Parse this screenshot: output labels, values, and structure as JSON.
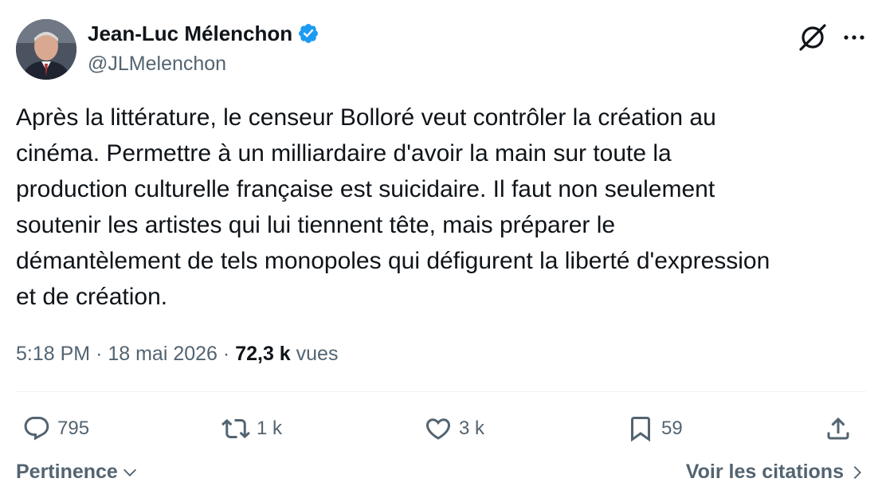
{
  "author": {
    "display_name": "Jean-Luc Mélenchon",
    "handle": "@JLMelenchon",
    "verified_color": "#1d9bf0"
  },
  "header_icons": [
    "grok-icon",
    "more-icon"
  ],
  "tweet": {
    "text": "Après la littérature, le censeur Bolloré veut contrôler la création au\ncinéma. Permettre à un milliardaire d'avoir la main sur toute la\nproduction culturelle française est suicidaire. Il faut non seulement\nsoutenir les artistes qui lui tiennent tête, mais préparer le\ndémantèlement de tels monopoles qui défigurent la liberté d'expression\net de création."
  },
  "meta": {
    "time": "5:18 PM",
    "separator": "·",
    "date": "18 mai 2026",
    "views_count": "72,3 k",
    "views_label": "vues"
  },
  "actions": {
    "replies": "795",
    "reposts": "1 k",
    "likes": "3 k",
    "bookmarks": "59"
  },
  "footer": {
    "sort_label": "Pertinence",
    "quotes_label": "Voir les citations"
  },
  "colors": {
    "text_primary": "#0f1419",
    "text_secondary": "#536471",
    "divider": "#eff3f4"
  }
}
